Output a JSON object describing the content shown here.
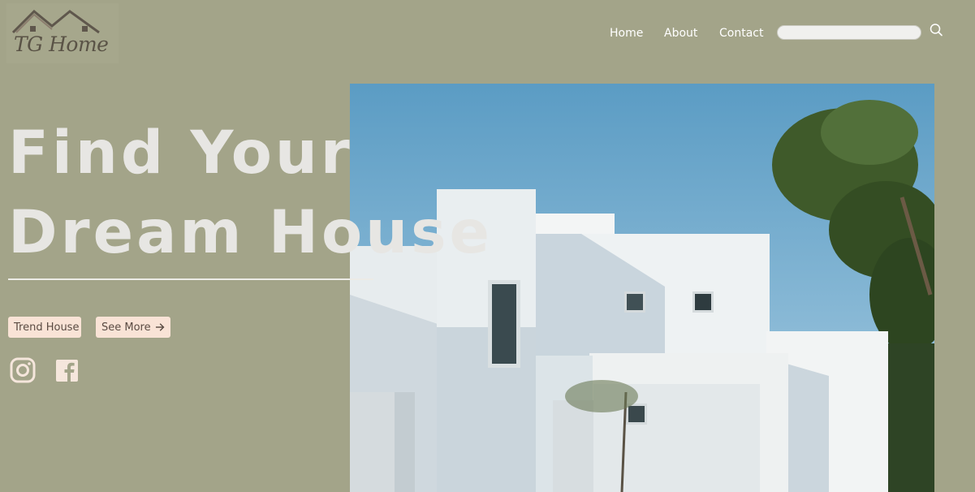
{
  "brand": {
    "logo_text": "TG Home"
  },
  "nav": {
    "items": [
      "Home",
      "About",
      "Contact"
    ]
  },
  "search": {
    "value": "",
    "placeholder": ""
  },
  "hero": {
    "headline_line1": "Find Your",
    "headline_line2": "Dream House",
    "button_trend": "Trend House",
    "button_more": "See More"
  },
  "social": [
    "instagram-icon",
    "facebook-icon"
  ],
  "colors": {
    "background": "#a3a489",
    "button_bg": "#f9e3d6",
    "headline": "#e7e6e3"
  }
}
